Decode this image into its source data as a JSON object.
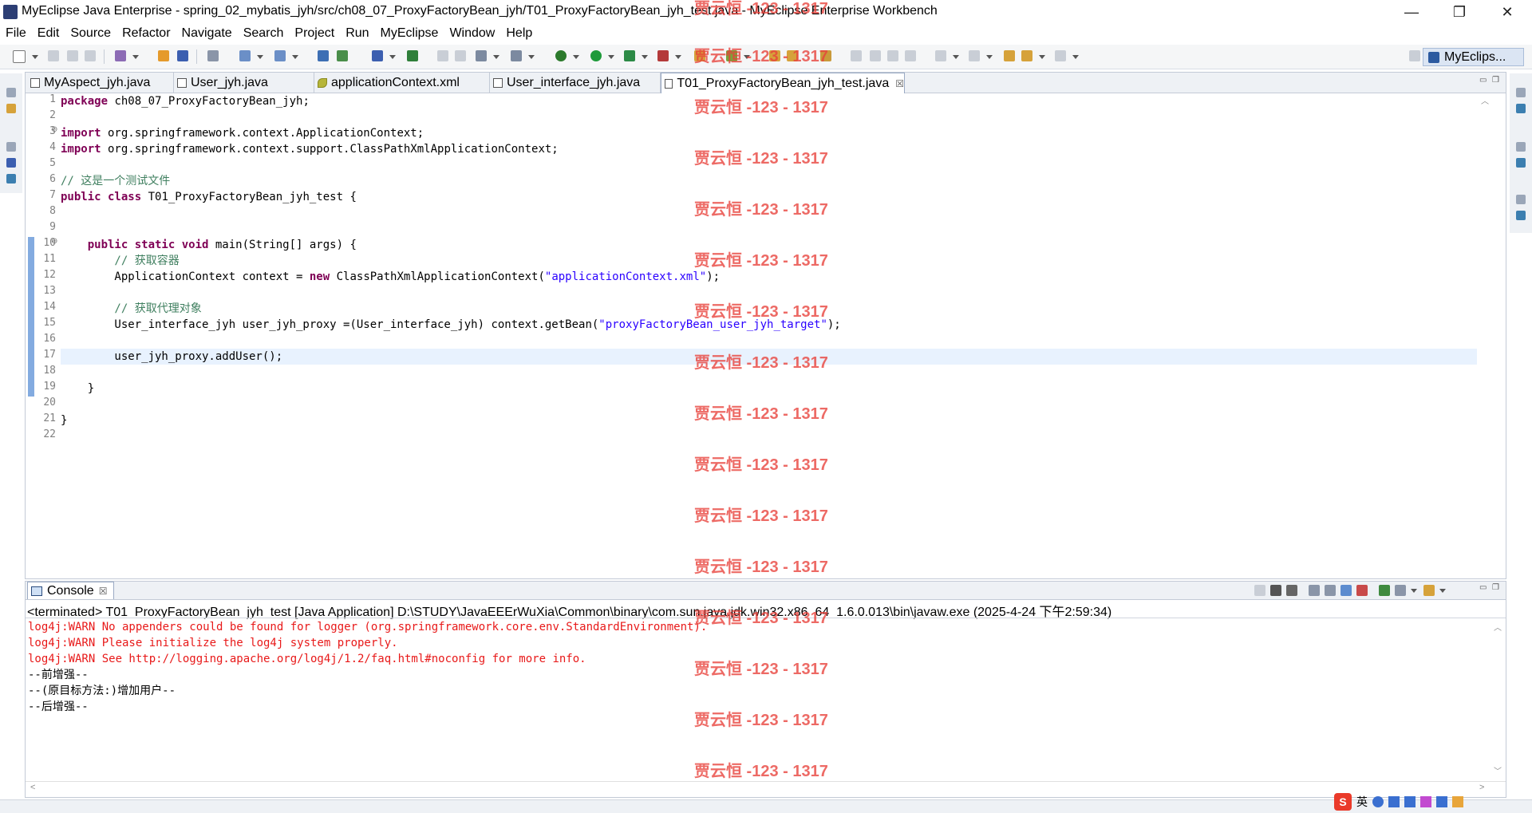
{
  "window": {
    "title": "MyEclipse Java Enterprise - spring_02_mybatis_jyh/src/ch08_07_ProxyFactoryBean_jyh/T01_ProxyFactoryBean_jyh_test.java - MyEclipse Enterprise Workbench",
    "minimize": "—",
    "restore": "❐",
    "close": "✕"
  },
  "menu": [
    "File",
    "Edit",
    "Source",
    "Refactor",
    "Navigate",
    "Search",
    "Project",
    "Run",
    "MyEclipse",
    "Window",
    "Help"
  ],
  "perspective": {
    "label": "MyEclips..."
  },
  "tabs": [
    {
      "label": "MyAspect_jyh.java"
    },
    {
      "label": "User_jyh.java"
    },
    {
      "label": "applicationContext.xml"
    },
    {
      "label": "User_interface_jyh.java"
    },
    {
      "label": "T01_ProxyFactoryBean_jyh_test.java",
      "active": true
    }
  ],
  "tab_close": "☒",
  "line_numbers": [
    "1",
    "2",
    "3",
    "4",
    "5",
    "6",
    "7",
    "8",
    "9",
    "10",
    "11",
    "12",
    "13",
    "14",
    "15",
    "16",
    "17",
    "18",
    "19",
    "20",
    "21",
    "22"
  ],
  "code": {
    "l1_kw": "package",
    "l1_rest": " ch08_07_ProxyFactoryBean_jyh;",
    "l3_kw": "import",
    "l3_rest": " org.springframework.context.ApplicationContext;",
    "l4_kw": "import",
    "l4_rest": " org.springframework.context.support.ClassPathXmlApplicationContext;",
    "l6_cm": "// 这是一个测试文件",
    "l7_kw": "public class",
    "l7_rest": " T01_ProxyFactoryBean_jyh_test {",
    "l10_ind": "    ",
    "l10_kw": "public static void",
    "l10_rest": " main(String[] args) {",
    "l11_cm": "        // 获取容器",
    "l12_a": "        ApplicationContext context = ",
    "l12_kw": "new",
    "l12_b": " ClassPathXmlApplicationContext(",
    "l12_st": "\"applicationContext.xml\"",
    "l12_c": ");",
    "l14_cm": "        // 获取代理对象",
    "l15_a": "        User_interface_jyh user_jyh_proxy =(User_interface_jyh) context.getBean(",
    "l15_st": "\"proxyFactoryBean_user_jyh_target\"",
    "l15_c": ");",
    "l17": "        user_jyh_proxy.addUser();",
    "l19": "    }",
    "l21": "}"
  },
  "console": {
    "tab_label": "Console",
    "tab_close": "☒",
    "header": "<terminated> T01_ProxyFactoryBean_jyh_test [Java Application] D:\\STUDY\\JavaEEErWuXia\\Common\\binary\\com.sun.java.jdk.win32.x86_64_1.6.0.013\\bin\\javaw.exe (2025-4-24 下午2:59:34)",
    "lines": [
      "log4j:WARN No appenders could be found for logger (org.springframework.core.env.StandardEnvironment).",
      "log4j:WARN Please initialize the log4j system properly.",
      "log4j:WARN See http://logging.apache.org/log4j/1.2/faq.html#noconfig for more info.",
      "--前增强--",
      "--(原目标方法:)增加用户--",
      "--后增强--"
    ]
  },
  "watermark": "贾云恒 -123 - 1317",
  "tray": {
    "ime_logo": "S",
    "ime_lang": "英"
  }
}
